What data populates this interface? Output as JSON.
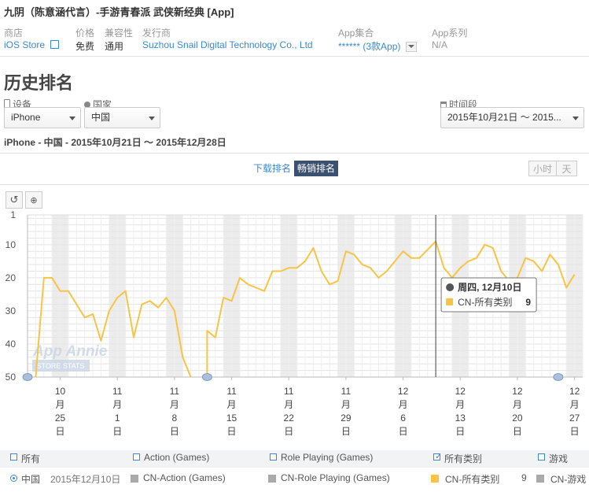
{
  "app": {
    "title": "九阴（陈意涵代言）-手游青春派 武侠新经典 [App]",
    "store_label": "商店",
    "store_value": "iOS Store",
    "price_label": "价格",
    "price_value": "免费",
    "compat_label": "兼容性",
    "compat_value": "通用",
    "publisher_label": "发行商",
    "publisher_value": "Suzhou Snail Digital Technology Co., Ltd",
    "collection_label": "App集合",
    "collection_value": "****** (3款App)",
    "series_label": "App系列",
    "series_value": "N/A"
  },
  "page": {
    "heading": "历史排名",
    "device_label": "设备",
    "device_value": "iPhone",
    "country_label": "国家",
    "country_value": "中国",
    "period_label": "时间段",
    "period_value": "2015年10月21日 ～ 2015...",
    "subtitle": "iPhone - 中国 - 2015年10月21日 ～ 2015年12月28日",
    "tab_downloads": "下载排名",
    "tab_grossing": "畅销排名",
    "btn_hour": "小时",
    "btn_day": "天",
    "watermark_top": "App Annie",
    "watermark_bottom": "STORE STATS"
  },
  "legend": {
    "items": [
      "所有",
      "Action (Games)",
      "Role Playing (Games)",
      "所有类别",
      "游戏"
    ],
    "country": "中国",
    "date": "2015年12月10日",
    "series": [
      "CN-Action (Games)",
      "CN-Role Playing (Games)",
      "CN-所有类别",
      "CN-游戏"
    ],
    "series_value": "9"
  },
  "tooltip": {
    "date": "周四, 12月10日",
    "series": "CN-所有类别",
    "value": "9"
  },
  "colors": {
    "line": "#f7c445",
    "link": "#3a8ad0",
    "weekend": "#ececec"
  },
  "chart_data": {
    "type": "line",
    "y_reversed": true,
    "ylim": [
      1,
      50
    ],
    "yticks": [
      1,
      10,
      20,
      30,
      40,
      50
    ],
    "xticks": [
      {
        "date": "2015-10-25",
        "label": "10月25日"
      },
      {
        "date": "2015-11-01",
        "label": "11月1日"
      },
      {
        "date": "2015-11-08",
        "label": "11月8日"
      },
      {
        "date": "2015-11-15",
        "label": "11月15日"
      },
      {
        "date": "2015-11-22",
        "label": "11月22日"
      },
      {
        "date": "2015-11-29",
        "label": "11月29日"
      },
      {
        "date": "2015-12-06",
        "label": "12月6日"
      },
      {
        "date": "2015-12-13",
        "label": "12月13日"
      },
      {
        "date": "2015-12-20",
        "label": "12月20日"
      },
      {
        "date": "2015-12-27",
        "label": "12月27日"
      }
    ],
    "x_range": [
      "2015-10-21",
      "2015-12-28"
    ],
    "series": [
      {
        "name": "CN-所有类别",
        "color": "#f7c445",
        "points": [
          [
            "2015-10-22",
            50
          ],
          [
            "2015-10-23",
            20
          ],
          [
            "2015-10-24",
            20
          ],
          [
            "2015-10-25",
            24
          ],
          [
            "2015-10-26",
            24
          ],
          [
            "2015-10-27",
            28
          ],
          [
            "2015-10-28",
            32
          ],
          [
            "2015-10-29",
            31
          ],
          [
            "2015-10-30",
            39
          ],
          [
            "2015-10-31",
            30
          ],
          [
            "2015-11-01",
            26
          ],
          [
            "2015-11-02",
            24
          ],
          [
            "2015-11-03",
            38
          ],
          [
            "2015-11-04",
            28
          ],
          [
            "2015-11-05",
            27
          ],
          [
            "2015-11-06",
            29
          ],
          [
            "2015-11-07",
            26
          ],
          [
            "2015-11-08",
            30
          ],
          [
            "2015-11-09",
            44
          ],
          [
            "2015-11-10",
            50
          ],
          null,
          [
            "2015-11-12",
            50
          ],
          [
            "2015-11-12",
            36
          ],
          [
            "2015-11-13",
            38
          ],
          [
            "2015-11-14",
            26
          ],
          [
            "2015-11-15",
            27
          ],
          [
            "2015-11-16",
            20
          ],
          [
            "2015-11-17",
            22
          ],
          [
            "2015-11-18",
            23
          ],
          [
            "2015-11-19",
            24
          ],
          [
            "2015-11-20",
            18
          ],
          [
            "2015-11-21",
            18
          ],
          [
            "2015-11-22",
            17
          ],
          [
            "2015-11-23",
            17
          ],
          [
            "2015-11-24",
            15
          ],
          [
            "2015-11-25",
            11
          ],
          [
            "2015-11-26",
            18
          ],
          [
            "2015-11-27",
            22
          ],
          [
            "2015-11-28",
            21
          ],
          [
            "2015-11-29",
            12
          ],
          [
            "2015-11-30",
            13
          ],
          [
            "2015-12-01",
            16
          ],
          [
            "2015-12-02",
            17
          ],
          [
            "2015-12-03",
            20
          ],
          [
            "2015-12-04",
            18
          ],
          [
            "2015-12-05",
            15
          ],
          [
            "2015-12-06",
            12
          ],
          [
            "2015-12-07",
            14
          ],
          [
            "2015-12-08",
            14
          ],
          [
            "2015-12-10",
            9
          ],
          [
            "2015-12-11",
            17
          ],
          [
            "2015-12-12",
            20
          ],
          [
            "2015-12-13",
            17
          ],
          [
            "2015-12-14",
            15
          ],
          [
            "2015-12-15",
            14
          ],
          [
            "2015-12-16",
            10
          ],
          [
            "2015-12-17",
            11
          ],
          [
            "2015-12-18",
            18
          ],
          [
            "2015-12-19",
            21
          ],
          [
            "2015-12-20",
            20
          ],
          [
            "2015-12-21",
            14
          ],
          [
            "2015-12-22",
            15
          ],
          [
            "2015-12-23",
            18
          ],
          [
            "2015-12-24",
            13
          ],
          [
            "2015-12-25",
            16
          ],
          [
            "2015-12-26",
            23
          ],
          [
            "2015-12-27",
            19
          ]
        ]
      }
    ],
    "highlight": {
      "date": "2015-12-10",
      "value": 9
    },
    "grid": true,
    "legend": "bottom"
  }
}
